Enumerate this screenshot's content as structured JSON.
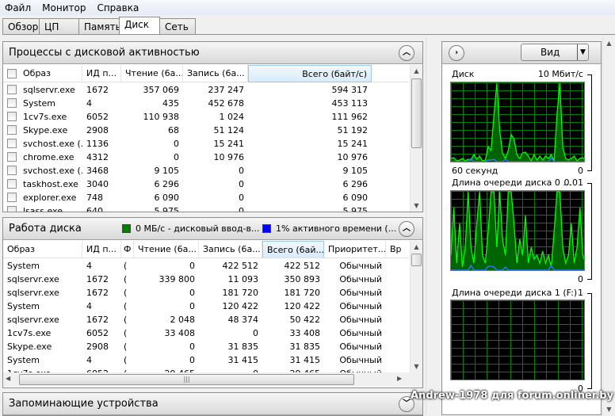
{
  "menu": [
    "Файл",
    "Монитор",
    "Справка"
  ],
  "tabs": [
    "Обзор",
    "ЦП",
    "Память",
    "Диск",
    "Сеть"
  ],
  "active_tab": "Диск",
  "processes": {
    "title": "Процессы с дисковой активностью",
    "columns": [
      "Образ",
      "ИД п...",
      "Чтение (6а...",
      "Запись (6а...",
      "Всего (байт/с)"
    ],
    "rows": [
      [
        "sqlservr.exe",
        "1672",
        "357 069",
        "237 247",
        "594 317"
      ],
      [
        "System",
        "4",
        "435",
        "452 678",
        "453 113"
      ],
      [
        "1cv7s.exe",
        "6052",
        "110 938",
        "1 024",
        "111 962"
      ],
      [
        "Skype.exe",
        "2908",
        "68",
        "51 124",
        "51 192"
      ],
      [
        "svchost.exe (...",
        "1136",
        "0",
        "15 241",
        "15 241"
      ],
      [
        "chrome.exe",
        "4312",
        "0",
        "10 976",
        "10 976"
      ],
      [
        "svchost.exe (...",
        "3468",
        "9 105",
        "0",
        "9 105"
      ],
      [
        "taskhost.exe",
        "3040",
        "6 296",
        "0",
        "6 296"
      ],
      [
        "explorer.exe",
        "748",
        "6 090",
        "0",
        "6 090"
      ],
      [
        "lsass.exe",
        "640",
        "5 975",
        "0",
        "5 975"
      ]
    ]
  },
  "disk_activity": {
    "title": "Работа диска",
    "legend_io": "0 МБ/с - дисковый ввод-в...",
    "legend_active": "1% активного времени (...",
    "legend_io_color": "#008000",
    "legend_active_color": "#0000ff",
    "columns": [
      "Образ",
      "ИД п...",
      "Ф",
      "Чтение (6а...",
      "Запись (6а...",
      "Всего (6ай...",
      "Приоритет...",
      "Вр"
    ],
    "rows": [
      [
        "System",
        "4",
        "(",
        "0",
        "422 512",
        "422 512",
        "Обычный"
      ],
      [
        "sqlservr.exe",
        "1672",
        "(",
        "339 800",
        "11 093",
        "350 893",
        "Обычный"
      ],
      [
        "sqlservr.exe",
        "1672",
        "(",
        "0",
        "181 720",
        "181 720",
        "Обычный"
      ],
      [
        "System",
        "4",
        "(",
        "0",
        "120 422",
        "120 422",
        "Обычный"
      ],
      [
        "sqlservr.exe",
        "1672",
        "(",
        "2 048",
        "48 374",
        "50 422",
        "Обычный"
      ],
      [
        "1cv7s.exe",
        "6052",
        "(",
        "33 408",
        "0",
        "33 408",
        "Обычный"
      ],
      [
        "Skype.exe",
        "2908",
        "(",
        "0",
        "31 835",
        "31 835",
        "Обычный"
      ],
      [
        "System",
        "4",
        "(",
        "0",
        "31 415",
        "31 415",
        "Обычный"
      ],
      [
        "1cv7s.exe",
        "6052",
        "(",
        "29 465",
        "0",
        "29 465",
        "Обычный"
      ]
    ]
  },
  "storage": {
    "title": "Запоминающие устройства"
  },
  "right": {
    "view_label": "Вид",
    "graphs": [
      {
        "title": "Диск",
        "max": "10 Мбит/с",
        "min": "0",
        "time": "60 секунд",
        "series": [
          0.05,
          0.06,
          0.02,
          0.03,
          0.05,
          0.02,
          0.04,
          0.03,
          0.1,
          0.04,
          0.08,
          0.02,
          0.03,
          0.2,
          0.15,
          0.6,
          1.0,
          0.4,
          0.12,
          0.05,
          0.15,
          0.35,
          0.3,
          0.1,
          0.05,
          0.12,
          0.13,
          0.08,
          0.02,
          0.1,
          0.03,
          0.08,
          0.03,
          0.08,
          0.05,
          0.1,
          0.02,
          0.6,
          1.0,
          0.2,
          0.05,
          0.03,
          0.05,
          0.08,
          0.02,
          0.05,
          0.06,
          0.03
        ],
        "blue": [
          0,
          0,
          0,
          0,
          0,
          0,
          0,
          0.04,
          0,
          0,
          0,
          0,
          0,
          0.02,
          0.02,
          0.03,
          0,
          0,
          0,
          0.03,
          0,
          0,
          0,
          0,
          0,
          0,
          0,
          0,
          0,
          0,
          0,
          0,
          0,
          0,
          0,
          0.05,
          0,
          0,
          0,
          0,
          0,
          0,
          0,
          0,
          0,
          0,
          0,
          0
        ]
      },
      {
        "title": "Длина очереди диска 0 ...",
        "max": "0.01",
        "min": "0",
        "series": [
          0.2,
          0.8,
          0.1,
          0.6,
          0.05,
          0.3,
          1.0,
          0.3,
          0.1,
          0.6,
          1.0,
          0.2,
          0.1,
          0.5,
          1.0,
          1.0,
          0.3,
          1.0,
          0.4,
          0.2,
          1.0,
          1.0,
          0.6,
          0.1,
          0.4,
          0.2,
          0.7,
          0.1,
          0.3,
          0.15,
          0.2,
          0.1,
          0.25,
          0.1,
          0.2,
          0.05,
          0.5,
          1.0,
          1.0,
          0.3,
          0.1,
          0.2,
          0.6,
          0.1,
          0.3,
          0.8,
          0.2,
          0.1
        ],
        "blue": [
          0,
          0,
          0,
          0,
          0,
          0,
          0,
          0.06,
          0,
          0,
          0,
          0,
          0,
          0.05,
          0.05,
          0.04,
          0,
          0,
          0,
          0.04,
          0,
          0,
          0,
          0,
          0,
          0,
          0,
          0,
          0,
          0,
          0,
          0,
          0,
          0,
          0,
          0.06,
          0,
          0,
          0,
          0,
          0,
          0,
          0,
          0,
          0,
          0,
          0,
          0
        ]
      },
      {
        "title": "Длина очереди диска 1 (F:)",
        "max": "1",
        "min": "0",
        "series": [],
        "blue": []
      }
    ]
  },
  "watermark": "Andrew-1978 для forum.onliner.by"
}
